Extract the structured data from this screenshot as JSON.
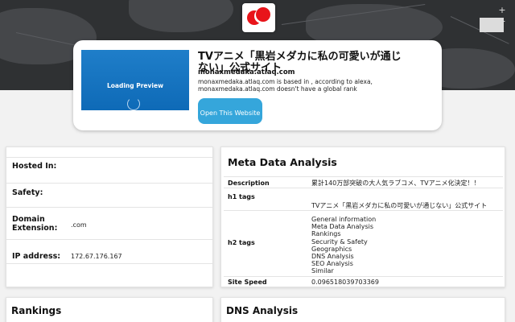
{
  "map": {
    "zoom_in": "+",
    "zoom_out": "−"
  },
  "logo": {
    "alt": "Atlaq logo"
  },
  "hero": {
    "preview_text": "Loading Preview",
    "title": "TVアニメ「黒岩メダカに私の可愛いが通じない」公式サイト",
    "domain": "monaxmedaka.atlaq.com",
    "description": "monaxmedaka.atlaq.com is based in , according to alexa, monaxmedaka.atlaq.com doesn't have a global rank",
    "open_button": "Open This Website"
  },
  "site_info": [
    {
      "label": "Hosted In:",
      "value": ""
    },
    {
      "label": "Safety:",
      "value": ""
    },
    {
      "label": "Domain Extension:",
      "value": ".com"
    },
    {
      "label": "IP address:",
      "value": "172.67.176.167"
    }
  ],
  "meta": {
    "heading": "Meta Data Analysis",
    "description_label": "Description",
    "description_value": "累計140万部突破の大人気ラブコメ、TVアニメ化決定！！",
    "h1_label": "h1 tags",
    "h1_value": "TVアニメ「黒岩メダカに私の可愛いが通じない」公式サイト",
    "h2_label": "h2 tags",
    "h2_values": [
      "General information",
      "Meta Data Analysis",
      "Rankings",
      "Security & Safety",
      "Geographics",
      "DNS Analysis",
      "SEO Analysis",
      "Similar"
    ],
    "speed_label": "Site Speed",
    "speed_value": "0.096518039703369"
  },
  "bottom": {
    "rankings": "Rankings",
    "dns": "DNS Analysis"
  }
}
